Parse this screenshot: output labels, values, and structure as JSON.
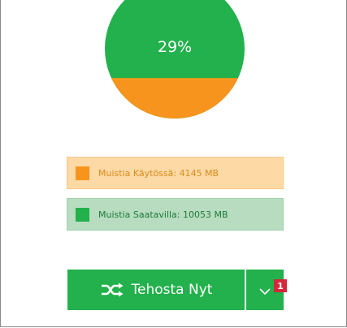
{
  "memory": {
    "used_percent_label": "29%",
    "used_fraction": 0.29,
    "legend": {
      "used_label": "Muistia Käytössä: 4145 MB",
      "available_label": "Muistia Saatavilla: 10053 MB"
    }
  },
  "actions": {
    "boost_label": "Tehosta Nyt",
    "boost_icon": "shuffle-icon",
    "dropdown_icon": "chevron-down-icon",
    "badge_count": "1"
  },
  "colors": {
    "available": "#22b14c",
    "used": "#f7941d",
    "badge": "#d6263a"
  }
}
